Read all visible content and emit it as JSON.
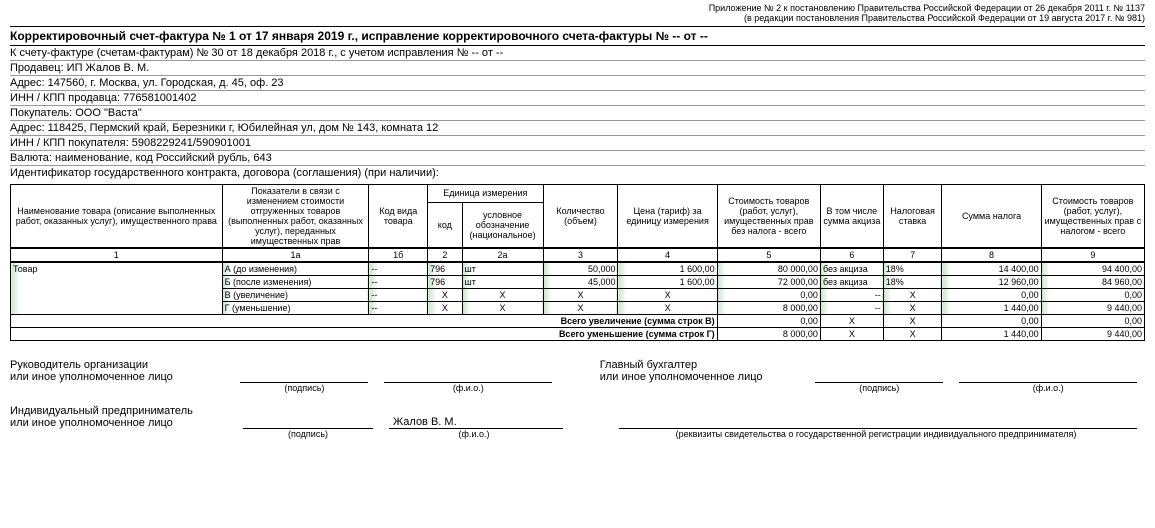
{
  "topnote": {
    "l1": "Приложение № 2 к постановлению Правительства Российской Федерации от 26 декабря 2011 г. № 1137",
    "l2": "(в редакции постановления Правительства Российской Федерации от 19 августа 2017 г. № 981)"
  },
  "title": "Корректировочный счет-фактура № 1 от 17 января 2019 г., исправление корректировочного счета-фактуры № -- от --",
  "info": {
    "ref": "К счету-фактуре (счетам-фактурам) № 30 от 18 декабря 2018 г., с учетом исправления № -- от --",
    "seller": "Продавец: ИП Жалов В. М.",
    "seller_addr": "Адрес: 147560, г. Москва, ул. Городская, д. 45, оф. 23",
    "seller_inn": "ИНН / КПП продавца: 776581001402",
    "buyer": "Покупатель: ООО \"Васта\"",
    "buyer_addr": "Адрес: 118425, Пермский край, Березники г, Юбилейная ул, дом № 143, комната 12",
    "buyer_inn": "ИНН / КПП покупателя: 5908229241/590901001",
    "currency": "Валюта: наименование, код Российский рубль, 643",
    "contract": "Идентификатор государственного контракта, договора (соглашения) (при наличии):"
  },
  "head": {
    "c1": "Наименование товара (описание выполненных работ, оказанных услуг), имущественного права",
    "c1a": "Показатели в связи с изменением стоимости отгруженных товаров (выполненных работ, оказанных услуг), переданных имущественных прав",
    "c1b": "Код вида товара",
    "unit_top": "Единица измерения",
    "c2": "код",
    "c2a": "условное обозначение (национальное)",
    "c3": "Количество (объем)",
    "c4": "Цена (тариф) за единицу измерения",
    "c5": "Стоимость товаров (работ, услуг), имущественных прав без налога - всего",
    "c6": "В том числе сумма акциза",
    "c7": "Налоговая ставка",
    "c8": "Сумма налога",
    "c9": "Стоимость товаров (работ, услуг), имущественных прав с налогом - всего"
  },
  "colnums": {
    "c1": "1",
    "c1a": "1а",
    "c1b": "1б",
    "c2": "2",
    "c2a": "2а",
    "c3": "3",
    "c4": "4",
    "c5": "5",
    "c6": "6",
    "c7": "7",
    "c8": "8",
    "c9": "9"
  },
  "rows": [
    {
      "name": "Товар",
      "ind": "А (до изменения)",
      "kvt": "--",
      "code": "796",
      "unit": "шт",
      "qty": "50,000",
      "price": "1 600,00",
      "sum": "80 000,00",
      "exc": "без акциза",
      "rate": "18%",
      "tax": "14 400,00",
      "total": "94 400,00"
    },
    {
      "name": "",
      "ind": "Б (после изменения)",
      "kvt": "--",
      "code": "796",
      "unit": "шт",
      "qty": "45,000",
      "price": "1 600,00",
      "sum": "72 000,00",
      "exc": "без акциза",
      "rate": "18%",
      "tax": "12 960,00",
      "total": "84 960,00"
    },
    {
      "name": "",
      "ind": "В (увеличение)",
      "kvt": "--",
      "code": "Х",
      "unit": "Х",
      "qty": "Х",
      "price": "Х",
      "sum": "0,00",
      "exc": "--",
      "rate": "Х",
      "tax": "0,00",
      "total": "0,00"
    },
    {
      "name": "",
      "ind": "Г (уменьшение)",
      "kvt": "--",
      "code": "Х",
      "unit": "Х",
      "qty": "Х",
      "price": "Х",
      "sum": "8 000,00",
      "exc": "--",
      "rate": "Х",
      "tax": "1 440,00",
      "total": "9 440,00"
    }
  ],
  "totals": [
    {
      "label": "Всего увеличение (сумма строк В)",
      "sum": "0,00",
      "exc": "Х",
      "rate": "Х",
      "tax": "0,00",
      "total": "0,00"
    },
    {
      "label": "Всего уменьшение (сумма строк Г)",
      "sum": "8 000,00",
      "exc": "Х",
      "rate": "Х",
      "tax": "1 440,00",
      "total": "9 440,00"
    }
  ],
  "sig": {
    "head_org1": "Руководитель организации",
    "head_org2": "или иное уполномоченное лицо",
    "chief_acc1": "Главный бухгалтер",
    "chief_acc2": "или иное уполномоченное лицо",
    "ip1": "Индивидуальный предприниматель",
    "ip2": "или иное уполномоченное лицо",
    "ip_name": "Жалов В. М.",
    "cap_sign": "(подпись)",
    "cap_fio": "(ф.и.о.)",
    "cap_req": "(реквизиты свидетельства о государственной регистрации индивидуального предпринимателя)"
  }
}
